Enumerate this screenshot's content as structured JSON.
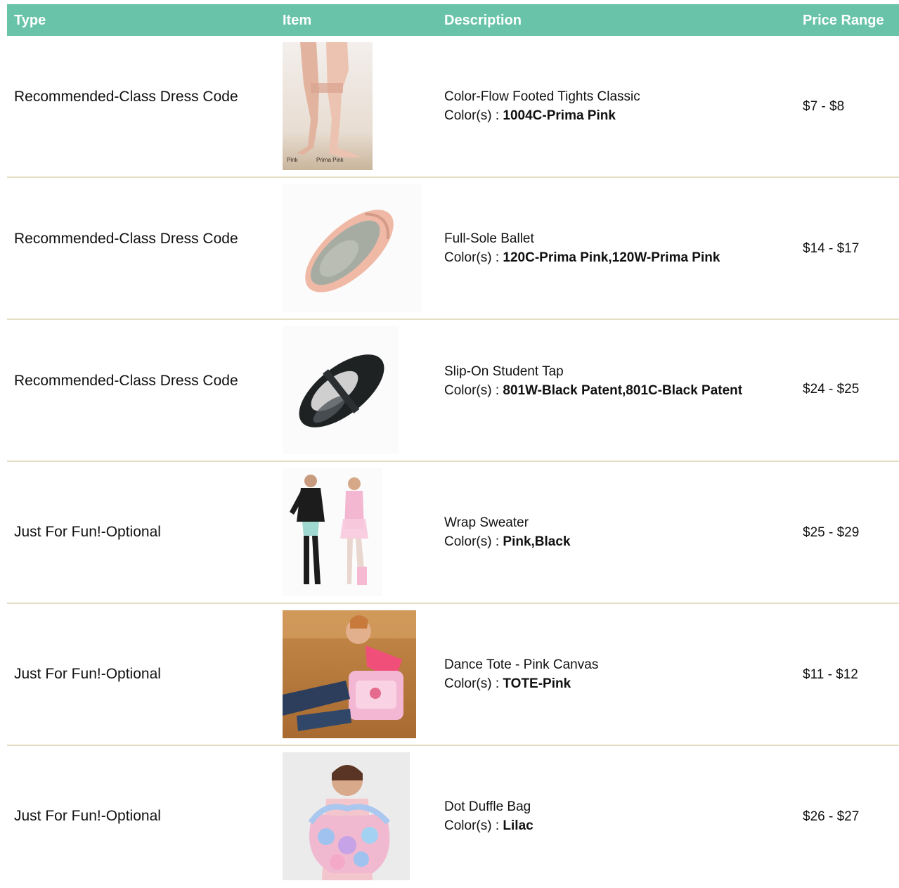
{
  "headers": {
    "type": "Type",
    "item": "Item",
    "description": "Description",
    "price": "Price Range"
  },
  "colors_prefix": "Color(s) : ",
  "accent_color": "#68c3a8",
  "divider_color": "#e4dfc2",
  "rows": [
    {
      "type": "Recommended-Class Dress Code",
      "name": "Color-Flow Footed Tights Classic",
      "colors": "1004C-Prima Pink",
      "price": "$7 - $8",
      "image": "footed-tights-photo",
      "image_captions": [
        "Pink",
        "Prima Pink"
      ]
    },
    {
      "type": "Recommended-Class Dress Code",
      "name": "Full-Sole Ballet",
      "colors": "120C-Prima Pink,120W-Prima Pink",
      "price": "$14 - $17",
      "image": "ballet-shoe-photo"
    },
    {
      "type": "Recommended-Class Dress Code",
      "name": "Slip-On Student Tap",
      "colors": "801W-Black Patent,801C-Black Patent",
      "price": "$24 - $25",
      "image": "tap-shoe-photo"
    },
    {
      "type": "Just For Fun!-Optional",
      "name": "Wrap Sweater",
      "colors": "Pink,Black",
      "price": "$25 - $29",
      "image": "wrap-sweater-photo"
    },
    {
      "type": "Just For Fun!-Optional",
      "name": "Dance Tote - Pink Canvas",
      "colors": "TOTE-Pink",
      "price": "$11 - $12",
      "image": "dance-tote-photo"
    },
    {
      "type": "Just For Fun!-Optional",
      "name": "Dot Duffle Bag",
      "colors": "Lilac",
      "price": "$26 - $27",
      "image": "duffle-bag-photo"
    }
  ]
}
